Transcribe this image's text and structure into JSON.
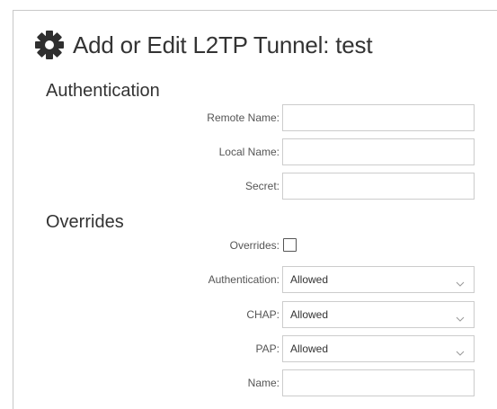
{
  "dialog": {
    "title": "Add or Edit L2TP Tunnel: test",
    "icon": "gear-icon"
  },
  "authentication": {
    "heading": "Authentication",
    "remote_name": {
      "label": "Remote Name:",
      "value": ""
    },
    "local_name": {
      "label": "Local Name:",
      "value": ""
    },
    "secret": {
      "label": "Secret:",
      "value": ""
    }
  },
  "overrides": {
    "heading": "Overrides",
    "overrides_checkbox": {
      "label": "Overrides:",
      "checked": false
    },
    "authentication_select": {
      "label": "Authentication:",
      "value": "Allowed",
      "icon": "chevron-down-icon"
    },
    "chap_select": {
      "label": "CHAP:",
      "value": "Allowed",
      "icon": "chevron-down-icon"
    },
    "pap_select": {
      "label": "PAP:",
      "value": "Allowed",
      "icon": "chevron-down-icon"
    },
    "name": {
      "label": "Name:",
      "value": ""
    }
  },
  "colors": {
    "text": "#333333",
    "label": "#555555",
    "border": "#cccccc",
    "icon": "#2f2f2f"
  }
}
